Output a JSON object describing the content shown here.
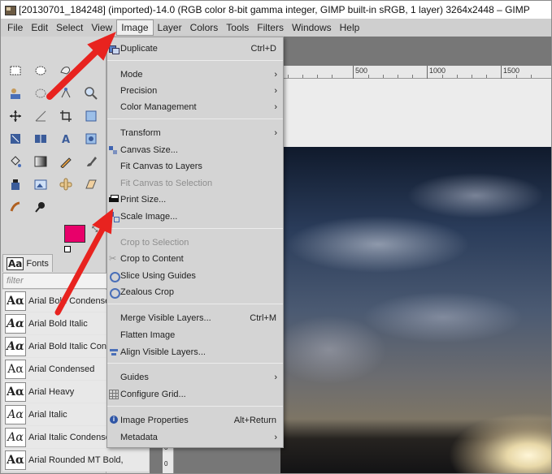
{
  "window": {
    "title": "[20130701_184248] (imported)-14.0 (RGB color 8-bit gamma integer, GIMP built-in sRGB, 1 layer) 3264x2448 – GIMP"
  },
  "menubar": {
    "items": [
      {
        "label": "File"
      },
      {
        "label": "Edit"
      },
      {
        "label": "Select"
      },
      {
        "label": "View"
      },
      {
        "label": "Image"
      },
      {
        "label": "Layer"
      },
      {
        "label": "Colors"
      },
      {
        "label": "Tools"
      },
      {
        "label": "Filters"
      },
      {
        "label": "Windows"
      },
      {
        "label": "Help"
      }
    ],
    "active": "Image"
  },
  "image_menu": {
    "items": [
      {
        "label": "Duplicate",
        "shortcut": "Ctrl+D",
        "icon": "duplicate-icon"
      },
      {
        "label": "Mode",
        "submenu": true
      },
      {
        "label": "Precision",
        "submenu": true
      },
      {
        "label": "Color Management",
        "submenu": true
      },
      {
        "label": "Transform",
        "submenu": true
      },
      {
        "label": "Canvas Size...",
        "icon": "canvas-size-icon"
      },
      {
        "label": "Fit Canvas to Layers"
      },
      {
        "label": "Fit Canvas to Selection",
        "disabled": true
      },
      {
        "label": "Print Size...",
        "icon": "print-size-icon"
      },
      {
        "label": "Scale Image...",
        "icon": "scale-image-icon"
      },
      {
        "label": "Crop to Selection",
        "disabled": true
      },
      {
        "label": "Crop to Content",
        "icon": "crop-icon"
      },
      {
        "label": "Slice Using Guides",
        "icon": "guides-icon"
      },
      {
        "label": "Zealous Crop",
        "icon": "guides-icon"
      },
      {
        "label": "Merge Visible Layers...",
        "shortcut": "Ctrl+M"
      },
      {
        "label": "Flatten Image"
      },
      {
        "label": "Align Visible Layers...",
        "icon": "align-icon"
      },
      {
        "label": "Guides",
        "submenu": true
      },
      {
        "label": "Configure Grid...",
        "icon": "grid-icon"
      },
      {
        "label": "Image Properties",
        "shortcut": "Alt+Return",
        "icon": "info-icon"
      },
      {
        "label": "Metadata",
        "submenu": true
      }
    ]
  },
  "toolbox": {
    "foreground_color": "#e8006a",
    "background_color": "#5a1035"
  },
  "fonts_panel": {
    "tab_label": "Fonts",
    "tab_icon_text": "Aa",
    "filter_placeholder": "filter",
    "sample_text": "Aα",
    "fonts": [
      {
        "name": "Arial Bold Condensed",
        "style": "bold"
      },
      {
        "name": "Arial Bold Italic",
        "style": "bold italic"
      },
      {
        "name": "Arial Bold Italic Conde",
        "style": "bold italic"
      },
      {
        "name": "Arial Condensed",
        "style": "normal"
      },
      {
        "name": "Arial Heavy",
        "style": "bold"
      },
      {
        "name": "Arial Italic",
        "style": "italic"
      },
      {
        "name": "Arial Italic Condensed",
        "style": "italic"
      },
      {
        "name": "Arial Rounded MT Bold,",
        "style": "bold"
      }
    ]
  },
  "ruler": {
    "labels": [
      "500",
      "1000",
      "1500"
    ]
  },
  "vertical_ruler": {
    "labels": [
      "0",
      "0"
    ]
  },
  "annotations": {
    "color": "#e8231f"
  }
}
